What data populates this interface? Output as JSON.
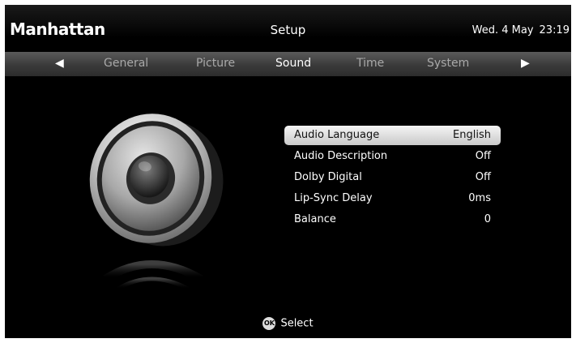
{
  "header": {
    "brand": "Manhattan",
    "title": "Setup",
    "date": "Wed. 4 May",
    "time": "23:19"
  },
  "tabs": {
    "items": [
      "General",
      "Picture",
      "Sound",
      "Time",
      "System"
    ],
    "active": "Sound"
  },
  "menu": {
    "items": [
      {
        "label": "Audio Language",
        "value": "English",
        "selected": true
      },
      {
        "label": "Audio Description",
        "value": "Off"
      },
      {
        "label": "Dolby Digital",
        "value": "Off"
      },
      {
        "label": "Lip-Sync Delay",
        "value": "0ms"
      },
      {
        "label": "Balance",
        "value": "0"
      }
    ]
  },
  "footer": {
    "ok_icon": "OK",
    "select_label": "Select"
  },
  "illustration": {
    "icon": "speaker-icon"
  }
}
